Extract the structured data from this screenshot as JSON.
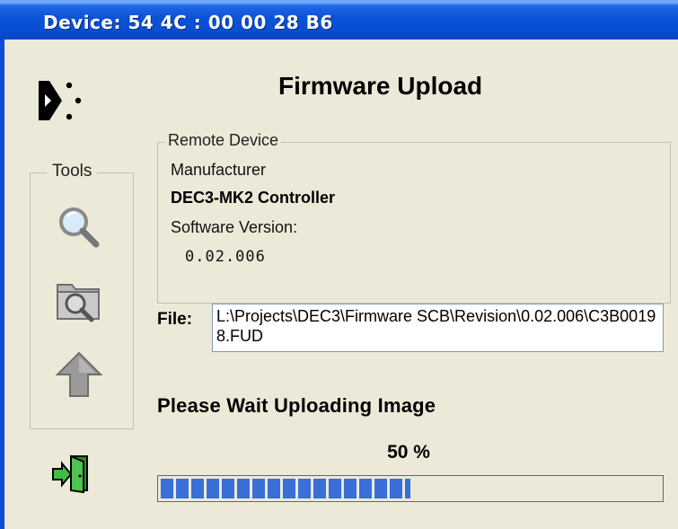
{
  "window": {
    "title": "Device:  54 4C : 00 00 28 B6"
  },
  "header": {
    "title": "Firmware Upload"
  },
  "tools": {
    "legend": "Tools",
    "items": [
      {
        "icon": "magnifier-icon"
      },
      {
        "icon": "folder-search-icon"
      },
      {
        "icon": "upload-arrow-icon"
      }
    ]
  },
  "exit": {
    "icon": "exit-door-icon"
  },
  "remote_device": {
    "legend": "Remote Device",
    "manufacturer_label": "Manufacturer",
    "manufacturer_value": "DEC3-MK2 Controller",
    "version_label": "Software Version:",
    "version_value": "0.02.006"
  },
  "file": {
    "label": "File:",
    "value": "L:\\Projects\\DEC3\\Firmware SCB\\Revision\\0.02.006\\C3B00198.FUD"
  },
  "status": {
    "message": "Please Wait  Uploading Image",
    "percent_text": "50 %",
    "progress": 0.5
  },
  "colors": {
    "titlebar": "#0a4fd3",
    "dialog_bg": "#ece9d8",
    "progress_fill": "#3a6fd8"
  }
}
